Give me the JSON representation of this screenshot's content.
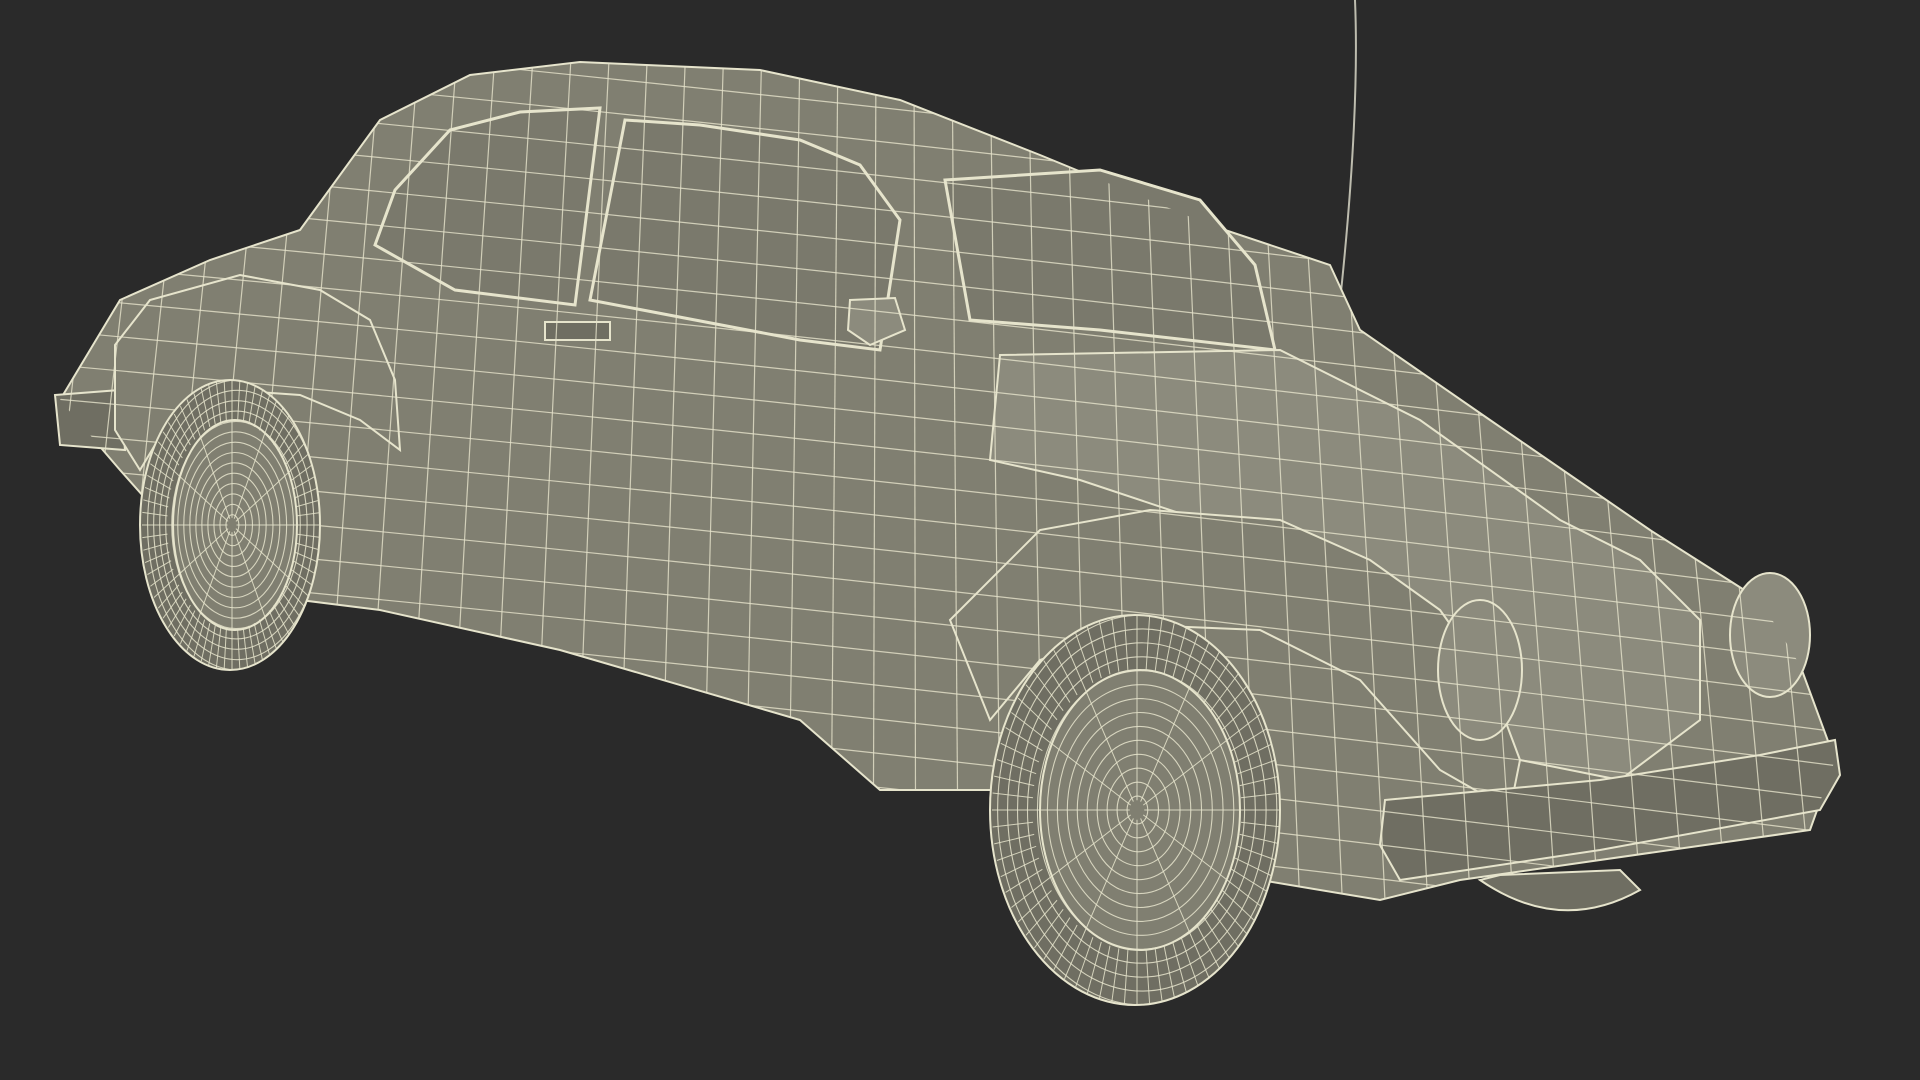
{
  "scene": {
    "background_color": "#2a2a2a",
    "body_fill": "#807f71",
    "body_fill_dark": "#6f6e62",
    "body_fill_light": "#8c8b7d",
    "wire_color": "#e6e4cc",
    "glass_fill": "#7a796c",
    "subject": "wireframe-car-model",
    "render_style": "wireframe-over-shaded"
  }
}
